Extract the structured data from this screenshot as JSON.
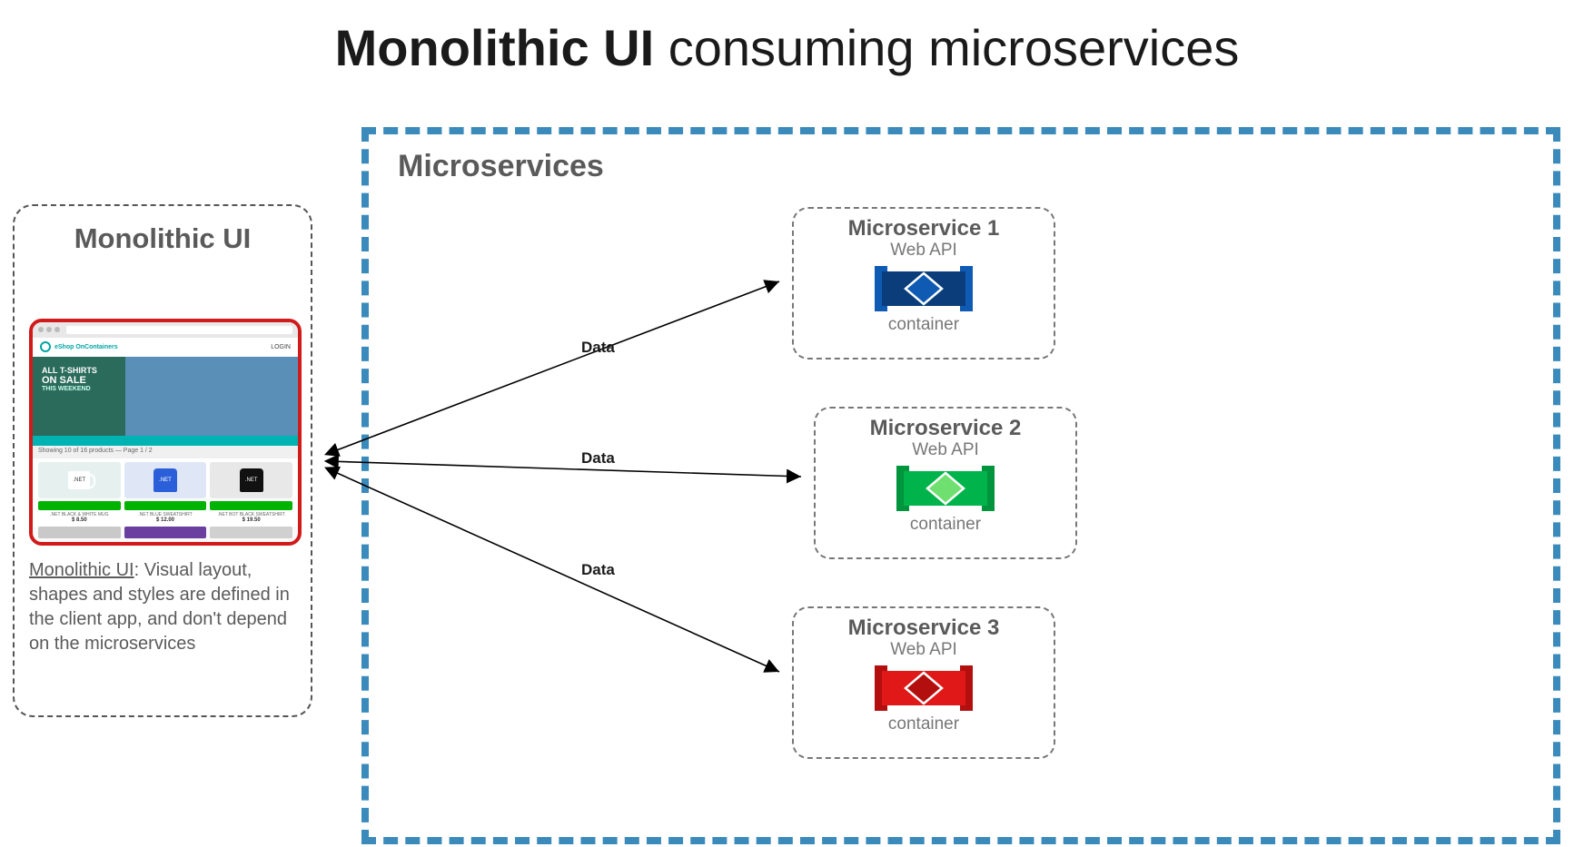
{
  "title_bold": "Monolithic UI",
  "title_rest": " consuming microservices",
  "monolithic_panel": {
    "heading": "Monolithic UI",
    "note_lead": "Monolithic UI",
    "note_body": ": Visual layout, shapes and styles are defined in the client app, and don't depend on the microservices",
    "mock": {
      "login": "LOGIN",
      "brand": "eShop OnContainers",
      "hero_line1": "ALL T-SHIRTS",
      "hero_line2": "ON SALE",
      "hero_line3": "THIS WEEKEND",
      "crumb": "Showing 10 of 16 products — Page 1 / 2",
      "products": [
        {
          "name": ".NET BLACK & WHITE MUG",
          "price": "$ 8.50",
          "tag": ".NET"
        },
        {
          "name": ".NET BLUE SWEATSHIRT",
          "price": "$ 12.00",
          "tag": ".NET"
        },
        {
          "name": ".NET BOT BLACK SWEATSHIRT",
          "price": "$ 19.50",
          "tag": ".NET"
        }
      ]
    }
  },
  "microservices_panel": {
    "heading": "Microservices",
    "services": [
      {
        "name": "Microservice 1",
        "api": "Web API",
        "container": "container",
        "color": "#0a3d7a",
        "accent": "#0f5ab3"
      },
      {
        "name": "Microservice 2",
        "api": "Web API",
        "container": "container",
        "color": "#0bb24a",
        "accent": "#5bd95a"
      },
      {
        "name": "Microservice 3",
        "api": "Web API",
        "container": "container",
        "color": "#d01818",
        "accent": "#a11010"
      }
    ]
  },
  "arrows": {
    "label1": "Data",
    "label2": "Data",
    "label3": "Data"
  }
}
